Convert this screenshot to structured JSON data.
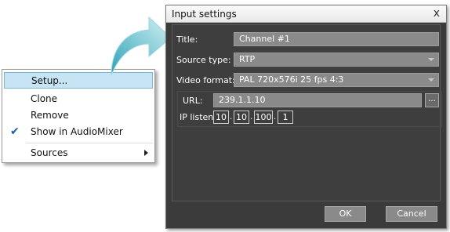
{
  "context_menu": {
    "items": [
      {
        "label": "Setup...",
        "active": true
      },
      {
        "label": "Clone"
      },
      {
        "label": "Remove"
      },
      {
        "label": "Show in AudioMixer",
        "checked": true
      },
      {
        "label": "Sources",
        "submenu": true
      }
    ]
  },
  "dialog": {
    "title": "Input settings",
    "close_glyph": "x",
    "title_label": "Title:",
    "title_value": "Channel #1",
    "source_type_label": "Source type:",
    "source_type_value": "RTP",
    "video_format_label": "Video format:",
    "video_format_value": "PAL 720x576i 25 fps 4:3",
    "url_label": "URL:",
    "url_value": "239.1.1.10",
    "browse_label": "...",
    "ip_listen_label": "IP listen:",
    "ip_octets": [
      "10",
      "10",
      "100",
      "1"
    ],
    "ok_label": "OK",
    "cancel_label": "Cancel"
  },
  "colors": {
    "menu_highlight": "#c7e4f5",
    "dialog_bg": "#3b3b3b",
    "field_bg": "#8a8a8a",
    "arrow_gradient_start": "#2aa3b6",
    "arrow_gradient_end": "#d7f1f4"
  },
  "icons": {
    "check": "checkmark-icon",
    "submenu": "chevron-right-icon",
    "pointer": "curved-arrow-icon"
  }
}
